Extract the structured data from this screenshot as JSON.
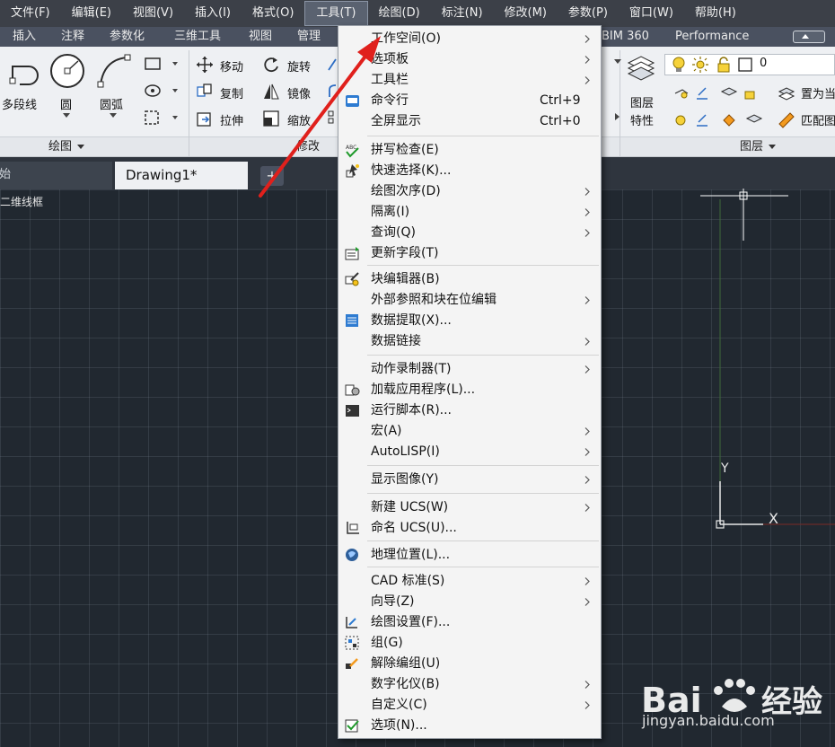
{
  "menubar": {
    "items": [
      "文件(F)",
      "编辑(E)",
      "视图(V)",
      "插入(I)",
      "格式(O)",
      "工具(T)",
      "绘图(D)",
      "标注(N)",
      "修改(M)",
      "参数(P)",
      "窗口(W)",
      "帮助(H)"
    ]
  },
  "ribbon_tabs": [
    "插入",
    "注释",
    "参数化",
    "三维工具",
    "视图",
    "管理",
    "BIM 360",
    "Performance"
  ],
  "ribbon": {
    "draw": {
      "polyline": "多段线",
      "circle": "圆",
      "arc": "圆弧",
      "title": "绘图"
    },
    "modify": {
      "move": "移动",
      "rotate": "旋转",
      "copy": "复制",
      "mirror": "镜像",
      "stretch": "拉伸",
      "scale": "缩放",
      "title": "修改"
    },
    "layers": {
      "layer_props_1": "图层",
      "layer_props_2": "特性",
      "layer_value": "0",
      "set_current": "置为当",
      "match": "匹配图",
      "title": "图层"
    }
  },
  "filetabs": {
    "start": "开始",
    "drawing": "Drawing1*",
    "close": "✕",
    "add": "+"
  },
  "viewport_label": "[-][俯视][二维线框]",
  "viewport_label_visible": "二维线框",
  "ucs": {
    "y": "Y",
    "x": "X"
  },
  "tools_menu": {
    "items": [
      {
        "label": "工作空间(O)",
        "shortcut": "",
        "submenu": true,
        "icon": ""
      },
      {
        "label": "选项板",
        "shortcut": "",
        "submenu": true,
        "icon": ""
      },
      {
        "label": "工具栏",
        "shortcut": "",
        "submenu": true,
        "icon": ""
      },
      {
        "label": "命令行",
        "shortcut": "Ctrl+9",
        "submenu": false,
        "icon": "command-line-icon"
      },
      {
        "label": "全屏显示",
        "shortcut": "Ctrl+0",
        "submenu": false,
        "icon": ""
      },
      {
        "label": "拼写检查(E)",
        "shortcut": "",
        "submenu": false,
        "icon": "spell-check-icon"
      },
      {
        "label": "快速选择(K)...",
        "shortcut": "",
        "submenu": false,
        "icon": "quick-select-icon"
      },
      {
        "label": "绘图次序(D)",
        "shortcut": "",
        "submenu": true,
        "icon": ""
      },
      {
        "label": "隔离(I)",
        "shortcut": "",
        "submenu": true,
        "icon": ""
      },
      {
        "label": "查询(Q)",
        "shortcut": "",
        "submenu": true,
        "icon": ""
      },
      {
        "label": "更新字段(T)",
        "shortcut": "",
        "submenu": false,
        "icon": "update-field-icon"
      },
      {
        "label": "块编辑器(B)",
        "shortcut": "",
        "submenu": false,
        "icon": "block-editor-icon"
      },
      {
        "label": "外部参照和块在位编辑",
        "shortcut": "",
        "submenu": true,
        "icon": ""
      },
      {
        "label": "数据提取(X)...",
        "shortcut": "",
        "submenu": false,
        "icon": "data-extraction-icon"
      },
      {
        "label": "数据链接",
        "shortcut": "",
        "submenu": true,
        "icon": ""
      },
      {
        "label": "动作录制器(T)",
        "shortcut": "",
        "submenu": true,
        "icon": ""
      },
      {
        "label": "加载应用程序(L)...",
        "shortcut": "",
        "submenu": false,
        "icon": "load-app-icon"
      },
      {
        "label": "运行脚本(R)...",
        "shortcut": "",
        "submenu": false,
        "icon": "run-script-icon"
      },
      {
        "label": "宏(A)",
        "shortcut": "",
        "submenu": true,
        "icon": ""
      },
      {
        "label": "AutoLISP(I)",
        "shortcut": "",
        "submenu": true,
        "icon": ""
      },
      {
        "label": "显示图像(Y)",
        "shortcut": "",
        "submenu": true,
        "icon": ""
      },
      {
        "label": "新建 UCS(W)",
        "shortcut": "",
        "submenu": true,
        "icon": ""
      },
      {
        "label": "命名 UCS(U)...",
        "shortcut": "",
        "submenu": false,
        "icon": "named-ucs-icon"
      },
      {
        "label": "地理位置(L)...",
        "shortcut": "",
        "submenu": false,
        "icon": "geolocation-icon"
      },
      {
        "label": "CAD 标准(S)",
        "shortcut": "",
        "submenu": true,
        "icon": ""
      },
      {
        "label": "向导(Z)",
        "shortcut": "",
        "submenu": true,
        "icon": ""
      },
      {
        "label": "绘图设置(F)...",
        "shortcut": "",
        "submenu": false,
        "icon": "drafting-settings-icon"
      },
      {
        "label": "组(G)",
        "shortcut": "",
        "submenu": false,
        "icon": "group-icon"
      },
      {
        "label": "解除编组(U)",
        "shortcut": "",
        "submenu": false,
        "icon": "ungroup-icon"
      },
      {
        "label": "数字化仪(B)",
        "shortcut": "",
        "submenu": true,
        "icon": ""
      },
      {
        "label": "自定义(C)",
        "shortcut": "",
        "submenu": true,
        "icon": ""
      },
      {
        "label": "选项(N)...",
        "shortcut": "",
        "submenu": false,
        "icon": "options-icon"
      }
    ]
  },
  "watermark": {
    "brand": "Bai 经验",
    "url": "jingyan.baidu.com"
  },
  "colors": {
    "menubar": "#3c4048",
    "canvas": "#212830",
    "arrow": "#e0201c",
    "menu_bg": "#f4f4f4"
  }
}
